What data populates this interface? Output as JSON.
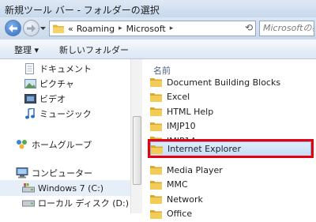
{
  "window": {
    "title": "新規ツール バー - フォルダーの選択"
  },
  "navigation": {
    "breadcrumb_prefix": "«",
    "breadcrumb": [
      "Roaming",
      "Microsoft"
    ],
    "search_placeholder": "Microsoftの検",
    "refresh_symbol": "⟲"
  },
  "toolbar": {
    "organize_label": "整理 ▾",
    "new_folder_label": "新しいフォルダー"
  },
  "sidebar": {
    "items": [
      {
        "label": "ドキュメント",
        "icon": "documents-icon"
      },
      {
        "label": "ピクチャ",
        "icon": "pictures-icon"
      },
      {
        "label": "ビデオ",
        "icon": "video-icon"
      },
      {
        "label": "ミュージック",
        "icon": "music-icon"
      },
      {
        "label": "ホームグループ",
        "icon": "homegroup-icon"
      },
      {
        "label": "コンピューター",
        "icon": "computer-icon"
      },
      {
        "label": "Windows 7 (C:)",
        "icon": "drive-icon",
        "selected": true
      },
      {
        "label": "ローカル ディスク (D:)",
        "icon": "drive-icon"
      }
    ]
  },
  "content": {
    "column_header": "名前",
    "folders": [
      "Document Building Blocks",
      "Excel",
      "HTML Help",
      "IMJP10",
      "IMJP14",
      "Internet Explorer",
      "Media Player",
      "MMC",
      "Network",
      "Office"
    ],
    "selected_folder": "Internet Explorer"
  },
  "colors": {
    "highlight_border": "#e8000e",
    "folder_yellow": "#f3cb57",
    "selection_bg": "#cfe4fa"
  }
}
